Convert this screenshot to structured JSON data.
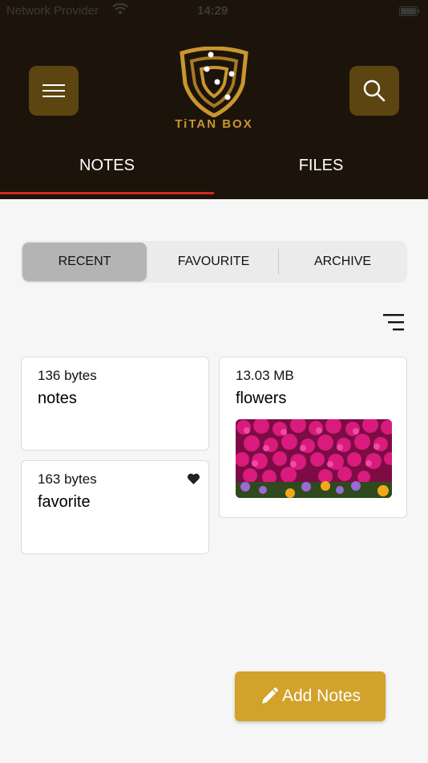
{
  "status_bar": {
    "carrier": "Network Provider",
    "time": "14:29"
  },
  "header": {
    "logo_text": "TiTAN BOX",
    "menu_icon": "hamburger-icon",
    "search_icon": "search-icon"
  },
  "tabs": [
    {
      "label": "NOTES",
      "active": true
    },
    {
      "label": "FILES",
      "active": false
    }
  ],
  "segments": [
    {
      "label": "RECENT",
      "selected": true
    },
    {
      "label": "FAVOURITE",
      "selected": false
    },
    {
      "label": "ARCHIVE",
      "selected": false
    }
  ],
  "items": [
    {
      "size": "136 bytes",
      "title": "notes",
      "favorite": false
    },
    {
      "size": "163 bytes",
      "title": "favorite",
      "favorite": true
    },
    {
      "size": "13.03 MB",
      "title": "flowers",
      "image": "flower-photo"
    }
  ],
  "add_button": {
    "label": "Add Notes",
    "icon": "pencil-icon"
  },
  "colors": {
    "header_bg": "#1c140b",
    "accent_gold": "#d2a22a",
    "button_brown": "#5c4511",
    "tab_indicator": "#d7261e"
  }
}
